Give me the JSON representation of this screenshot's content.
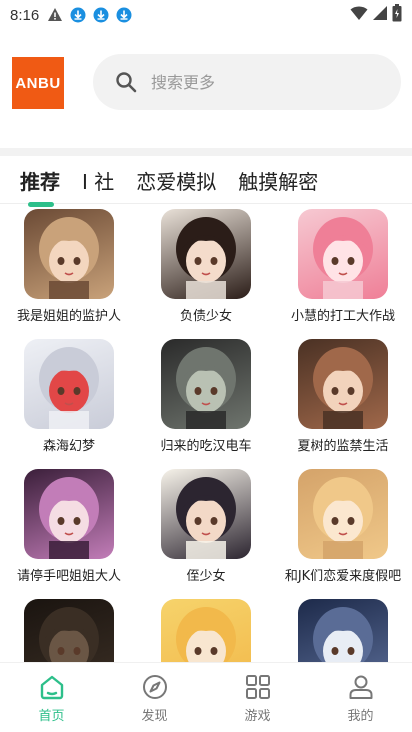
{
  "status_bar": {
    "time": "8:16",
    "left_icons": [
      "alert-icon",
      "download-icon",
      "download-icon",
      "download-icon"
    ],
    "right_icons": [
      "wifi-icon",
      "cellular-icon",
      "battery-icon"
    ]
  },
  "header": {
    "logo_text": "ANBU",
    "search_placeholder": "搜索更多"
  },
  "tabs": [
    {
      "label": "推荐",
      "active": true
    },
    {
      "label": "I 社",
      "active": false
    },
    {
      "label": "恋爱模拟",
      "active": false
    },
    {
      "label": "触摸解密",
      "active": false
    }
  ],
  "games": [
    {
      "title": "我是姐姐的监护人",
      "colors": [
        "#6b4a35",
        "#c9a27a",
        "#f3d6bf"
      ]
    },
    {
      "title": "负债少女",
      "colors": [
        "#e9e1d8",
        "#2b1d18",
        "#f4dccb"
      ]
    },
    {
      "title": "小慧的打工大作战",
      "colors": [
        "#f6c9d2",
        "#ef7f97",
        "#ffe3e6"
      ]
    },
    {
      "title": "森海幻梦",
      "colors": [
        "#eef0f5",
        "#c9ccd8",
        "#e24747"
      ]
    },
    {
      "title": "归来的吃汉电车",
      "colors": [
        "#2a2a2a",
        "#6f756e",
        "#b9c1b3"
      ]
    },
    {
      "title": "夏树的监禁生活",
      "colors": [
        "#4a3124",
        "#a0684a",
        "#f2d3bc"
      ]
    },
    {
      "title": "请停手吧姐姐大人",
      "colors": [
        "#3b1f3a",
        "#c27db8",
        "#f5dde3"
      ]
    },
    {
      "title": "侄少女",
      "colors": [
        "#f7f3ea",
        "#2c2530",
        "#f3d9c7"
      ]
    },
    {
      "title": "和JK们恋爱来度假吧",
      "colors": [
        "#d4a36a",
        "#f0c889",
        "#fbe7cf"
      ]
    },
    {
      "title": "",
      "colors": [
        "#1a1410",
        "#3a2e24",
        "#6a5645"
      ]
    },
    {
      "title": "",
      "colors": [
        "#f6d36b",
        "#f2b94b",
        "#f8e6d0"
      ]
    },
    {
      "title": "",
      "colors": [
        "#1d2a4a",
        "#5a6c96",
        "#e8edf5"
      ]
    }
  ],
  "bottom_nav": [
    {
      "label": "首页",
      "icon": "home-icon",
      "active": true
    },
    {
      "label": "发现",
      "icon": "compass-icon",
      "active": false
    },
    {
      "label": "游戏",
      "icon": "grid-icon",
      "active": false
    },
    {
      "label": "我的",
      "icon": "profile-icon",
      "active": false
    }
  ],
  "accent_color": "#2dbf8a",
  "logo_color": "#f05a14"
}
